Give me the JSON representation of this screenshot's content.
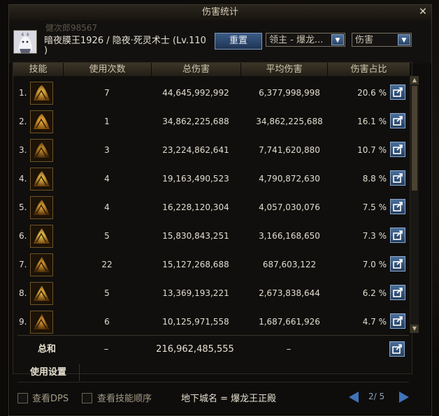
{
  "window": {
    "title": "伤害统计"
  },
  "header": {
    "sub_name": "健次郎98567",
    "character": "暗夜膜王1926 / 隐夜·死灵术士 (Lv.110",
    "character_cont": ")",
    "reset_label": "重置",
    "target_select": "领主 - 爆龙...",
    "type_select": "伤害"
  },
  "columns": [
    "技能",
    "使用次数",
    "总伤害",
    "平均伤害",
    "伤害占比"
  ],
  "rows": [
    {
      "index": "1.",
      "uses": "7",
      "total": "44,645,992,992",
      "avg": "6,377,998,998",
      "pct": "20.6 %",
      "icon": "skill-icon"
    },
    {
      "index": "2.",
      "uses": "1",
      "total": "34,862,225,688",
      "avg": "34,862,225,688",
      "pct": "16.1 %",
      "icon": "skill-icon"
    },
    {
      "index": "3.",
      "uses": "3",
      "total": "23,224,862,641",
      "avg": "7,741,620,880",
      "pct": "10.7 %",
      "icon": "skill-icon"
    },
    {
      "index": "4.",
      "uses": "4",
      "total": "19,163,490,523",
      "avg": "4,790,872,630",
      "pct": "8.8 %",
      "icon": "skill-icon"
    },
    {
      "index": "5.",
      "uses": "4",
      "total": "16,228,120,304",
      "avg": "4,057,030,076",
      "pct": "7.5 %",
      "icon": "skill-icon"
    },
    {
      "index": "6.",
      "uses": "5",
      "total": "15,830,843,251",
      "avg": "3,166,168,650",
      "pct": "7.3 %",
      "icon": "skill-icon"
    },
    {
      "index": "7.",
      "uses": "22",
      "total": "15,127,268,688",
      "avg": "687,603,122",
      "pct": "7.0 %",
      "icon": "skill-icon"
    },
    {
      "index": "8.",
      "uses": "5",
      "total": "13,369,193,221",
      "avg": "2,673,838,644",
      "pct": "6.2 %",
      "icon": "skill-icon"
    },
    {
      "index": "9.",
      "uses": "6",
      "total": "10,125,971,558",
      "avg": "1,687,661,926",
      "pct": "4.7 %",
      "icon": "skill-icon"
    }
  ],
  "total_row": {
    "label": "总和",
    "uses": "–",
    "total": "216,962,485,555",
    "avg": "–"
  },
  "settings": {
    "label": "使用设置"
  },
  "footer": {
    "check_dps": "查看DPS",
    "check_order": "查看技能顺序",
    "dungeon": "地下城名 = 爆龙王正殿",
    "page": "2/ 5"
  }
}
